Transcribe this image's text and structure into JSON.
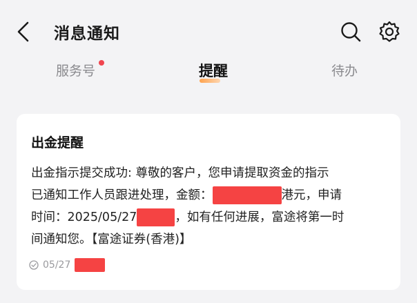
{
  "header": {
    "title": "消息通知",
    "back_icon": "back-arrow-icon",
    "search_icon": "search-icon",
    "settings_icon": "gear-icon"
  },
  "tabs": [
    {
      "label": "服务号",
      "has_badge": true
    },
    {
      "label": "提醒",
      "active": true
    },
    {
      "label": "待办"
    }
  ],
  "message": {
    "title": "出金提醒",
    "body": {
      "line1": "出金指示提交成功: 尊敬的客户，您申请提取资金的指示",
      "line2_a": "已通知工作人员跟进处理，金额：",
      "line2_b": "港元，申请",
      "line3_a": "时间：2025/05/27",
      "line3_b": "，如有任何进展，富途将第一时",
      "line4": "间通知您。【富途证券(香港)】"
    },
    "date": "05/27"
  },
  "colors": {
    "background": "#f3f3f5",
    "card": "#ffffff",
    "badge": "#f0454f",
    "redaction": "#f54343",
    "active_tab_underline": "#ff9a3c"
  }
}
